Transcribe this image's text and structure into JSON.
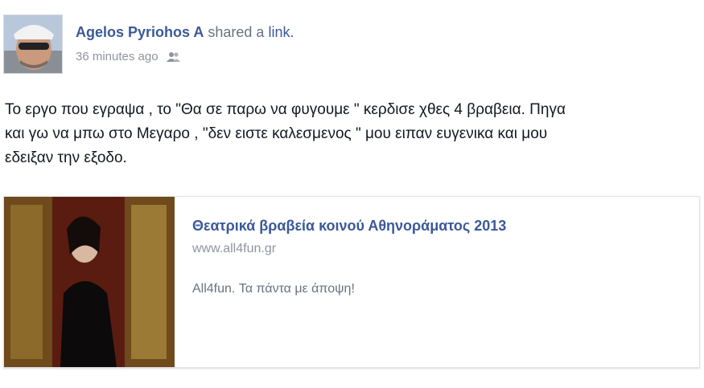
{
  "story": {
    "author_name": "Agelos Pyriohos A",
    "action_text": "shared a",
    "action_link": "link.",
    "timestamp": "36 minutes ago",
    "audience_icon": "friends-icon",
    "body_line1": "Το εργο που εγραψα , το \"Θα σε παρω να φυγουμε \" κερδισε χθες 4 βραβεια. Πηγα",
    "body_line2": "και γω να μπω στο Μεγαρο , \"δεν ειστε καλεσμενος \" μου ειπαν ευγενικα και μου",
    "body_line3": "εδειξαν την εξοδο."
  },
  "shared_link": {
    "title": "Θεατρικά βραβεία κοινού Αθηνοράματος 2013",
    "domain": "www.all4fun.gr",
    "description": "All4fun. Τα πάντα με άποψη!"
  },
  "colors": {
    "link_blue": "#3b5998",
    "meta_gray": "#90949c",
    "text": "#141823"
  }
}
